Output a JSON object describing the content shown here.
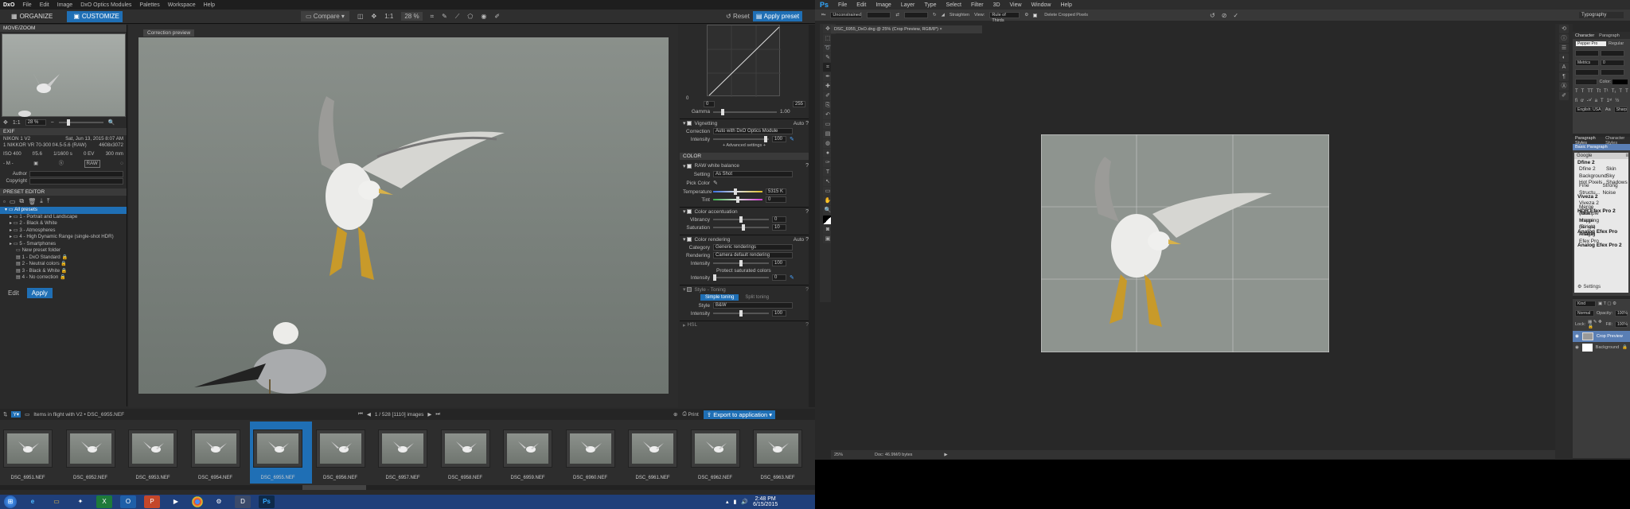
{
  "dxo": {
    "logo": "DxO",
    "menu": [
      "File",
      "Edit",
      "Image",
      "DxO Optics Modules",
      "Palettes",
      "Workspace",
      "Help"
    ],
    "tabs": [
      "ORGANIZE",
      "CUSTOMIZE"
    ],
    "toolbar": {
      "compare": "Compare",
      "zoom1": "1:1",
      "zoom": "28 %",
      "reset": "Reset",
      "apply": "Apply preset"
    },
    "movezoom": {
      "title": "MOVE/ZOOM",
      "zoom1": "1:1",
      "zoom": "28 %"
    },
    "exif": {
      "title": "EXIF",
      "camera": "NIKON 1 V2",
      "date": "Sat, Jun 13, 2015 8:07 AM",
      "lens": "1 NIKKOR VR 70-300 f/4.5-5.6 (RAW)",
      "dims": "4608x3072",
      "iso": "ISO 400",
      "aperture": "f/5.6",
      "shutter": "1/1600 s",
      "ev": "0 EV",
      "focal": "300 mm",
      "m": "- M -",
      "raw": "RAW",
      "author": "Author",
      "copyright": "Copyright"
    },
    "preset_editor": {
      "title": "PRESET EDITOR",
      "items": [
        "All presets",
        "1 - Portrait and Landscape",
        "2 - Black & White",
        "3 - Atmospheres",
        "4 - High Dynamic Range (single-shot HDR)",
        "5 - Smartphones",
        "New preset folder",
        "1 - DxO Standard",
        "2 - Neutral colors",
        "3 - Black & White",
        "4 - No correction"
      ],
      "edit": "Edit",
      "apply": "Apply"
    },
    "correction_preview": "Correction preview",
    "tone": {
      "in_min": "0",
      "in_max": "255",
      "out_min": "0",
      "gamma_label": "Gamma",
      "gamma": "1.00"
    },
    "vignetting": {
      "title": "Vignetting",
      "mode": "Auto",
      "correction_label": "Correction",
      "correction": "Auto with DxO Optics Module",
      "intensity_label": "Intensity",
      "intensity": "100",
      "advanced": "+ Advanced settings +"
    },
    "color": {
      "title": "COLOR"
    },
    "wb": {
      "title": "RAW white balance",
      "setting_label": "Setting",
      "setting": "As Shot",
      "pick": "Pick Color",
      "temp_label": "Temperature",
      "temp": "5315 K",
      "tint_label": "Tint",
      "tint": "0"
    },
    "accent": {
      "title": "Color accentuation",
      "vibrancy_label": "Vibrancy",
      "vibrancy": "0",
      "saturation_label": "Saturation",
      "saturation": "10"
    },
    "rendering": {
      "title": "Color rendering",
      "mode": "Auto",
      "category_label": "Category",
      "category": "Generic renderings",
      "rendering_label": "Rendering",
      "rendering": "Camera default rendering",
      "intensity_label": "Intensity",
      "intensity": "100",
      "protect": "Protect saturated colors",
      "intensity2": "0"
    },
    "style": {
      "title": "Style - Toning",
      "simple": "Simple toning",
      "split": "Split toning",
      "style_label": "Style",
      "style": "B&W",
      "intensity_label": "Intensity",
      "intensity": "100"
    },
    "hsl": "HSL",
    "bottom": {
      "folder": "Items in flight with V2 • DSC_6955.NEF",
      "count": "1 / 528 [1110] images",
      "print": "Print",
      "export": "Export to application"
    },
    "film": [
      "DSC_6951.NEF",
      "DSC_6952.NEF",
      "DSC_6953.NEF",
      "DSC_6954.NEF",
      "DSC_6955.NEF",
      "DSC_6956.NEF",
      "DSC_6957.NEF",
      "DSC_6958.NEF",
      "DSC_6959.NEF",
      "DSC_6960.NEF",
      "DSC_6961.NEF",
      "DSC_6962.NEF",
      "DSC_6963.NEF"
    ]
  },
  "ps": {
    "logo": "Ps",
    "menu": [
      "File",
      "Edit",
      "Image",
      "Layer",
      "Type",
      "Select",
      "Filter",
      "3D",
      "View",
      "Window",
      "Help"
    ],
    "options": {
      "ratio": "Unconstrained",
      "straighten": "Straighten",
      "view_label": "View:",
      "view": "Rule of Thirds",
      "delete": "Delete Cropped Pixels",
      "workspace": "Typography"
    },
    "doc_tab": "DSC_6955_DxO.dng @ 25% (Crop Preview, RGB/8*)",
    "status": {
      "zoom": "25%",
      "doc": "Doc: 46.9M/0 bytes"
    },
    "char_tabs": [
      "Character",
      "Paragraph"
    ],
    "font": "Pepper Pro",
    "font_style": "Regular",
    "metrics": "Metrics",
    "size": "0",
    "color_label": "Color:",
    "lang": "English: USA",
    "aa": "Aa",
    "aa_mode": "Sharp",
    "style_tabs": [
      "Paragraph Styles",
      "Character Styles"
    ],
    "basic": "Basic Paragraph",
    "google": "Google",
    "filters": [
      {
        "h": "Dfine 2"
      },
      {
        "r": "Dfine 2",
        "r2": "Skin"
      },
      {
        "r": "Background",
        "r2": "Sky"
      },
      {
        "r": "Hot Pixels",
        "r2": "Shadows"
      },
      {
        "r": "Fine Structu...",
        "r2": "Strong Noise"
      },
      {
        "h": "Viveza 2"
      },
      {
        "r": "Viveza 2",
        "r2": ""
      },
      {
        "h": "HDR Efex Pro 2"
      },
      {
        "r": "Merge (Multiple Image Series)",
        "r2": ""
      },
      {
        "r": "Tone Mapping (Single Image)",
        "r2": ""
      },
      {
        "h": "Analog Efex Pro"
      },
      {
        "r": "Analog Efex Pro",
        "r2": ""
      },
      {
        "h": "Analog Efex Pro 2"
      }
    ],
    "settings": "Settings",
    "layers": {
      "kind": "Kind",
      "mode": "Normal",
      "opacity_label": "Opacity:",
      "opacity": "100%",
      "lock_label": "Lock:",
      "fill_label": "Fill:",
      "fill": "100%",
      "items": [
        "Crop Preview",
        "Background"
      ]
    }
  },
  "taskbar": {
    "time": "2:48 PM",
    "date": "6/15/2015"
  }
}
